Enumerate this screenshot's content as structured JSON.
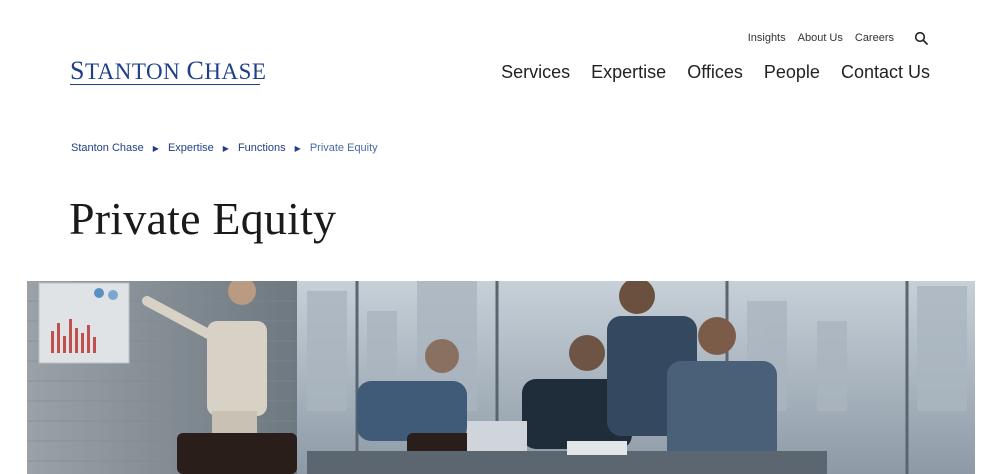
{
  "logo": {
    "text_first": "Stanton",
    "text_second": "Chase"
  },
  "utility_nav": {
    "items": [
      {
        "label": "Insights"
      },
      {
        "label": "About Us"
      },
      {
        "label": "Careers"
      }
    ],
    "search_icon": "search-icon"
  },
  "main_nav": {
    "items": [
      {
        "label": "Services"
      },
      {
        "label": "Expertise"
      },
      {
        "label": "Offices"
      },
      {
        "label": "People"
      },
      {
        "label": "Contact Us"
      }
    ]
  },
  "breadcrumb": {
    "items": [
      {
        "label": "Stanton Chase"
      },
      {
        "label": "Expertise"
      },
      {
        "label": "Functions"
      }
    ],
    "current": "Private Equity"
  },
  "page": {
    "title": "Private Equity"
  },
  "colors": {
    "brand": "#1f3f8a",
    "text": "#1a1a1a"
  }
}
